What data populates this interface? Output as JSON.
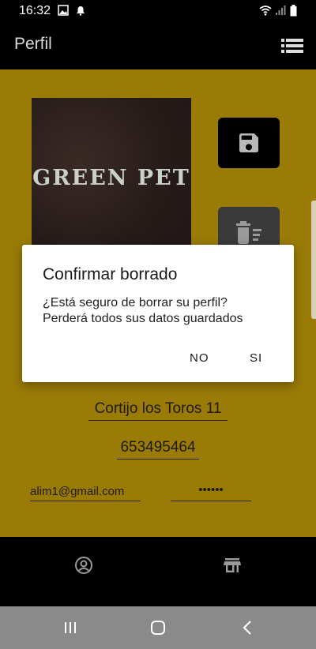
{
  "status_bar": {
    "time": "16:32",
    "icons": [
      "image-icon",
      "alarm-icon",
      "wifi-icon",
      "signal-icon",
      "battery-icon"
    ]
  },
  "app_bar": {
    "title": "Perfil",
    "menu_icon": "list-menu-icon"
  },
  "profile": {
    "logo_text": "GREEN PET",
    "address": "Cortijo los Toros 11",
    "phone": "653495464",
    "email": "alim1@gmail.com",
    "password": "••••••"
  },
  "actions": {
    "save_icon": "save-icon",
    "delete_icon": "delete-sweep-icon"
  },
  "dialog": {
    "title": "Confirmar borrado",
    "message_line1": "¿Está seguro de borrar su perfil?",
    "message_line2": "Perderá todos sus datos guardados",
    "no_label": "NO",
    "yes_label": "SI"
  },
  "bottom_nav": {
    "items": [
      "profile-icon",
      "store-icon"
    ]
  },
  "colors": {
    "background": "#9a7b07",
    "bars": "#000000",
    "system_nav": "#8a8a8a"
  }
}
